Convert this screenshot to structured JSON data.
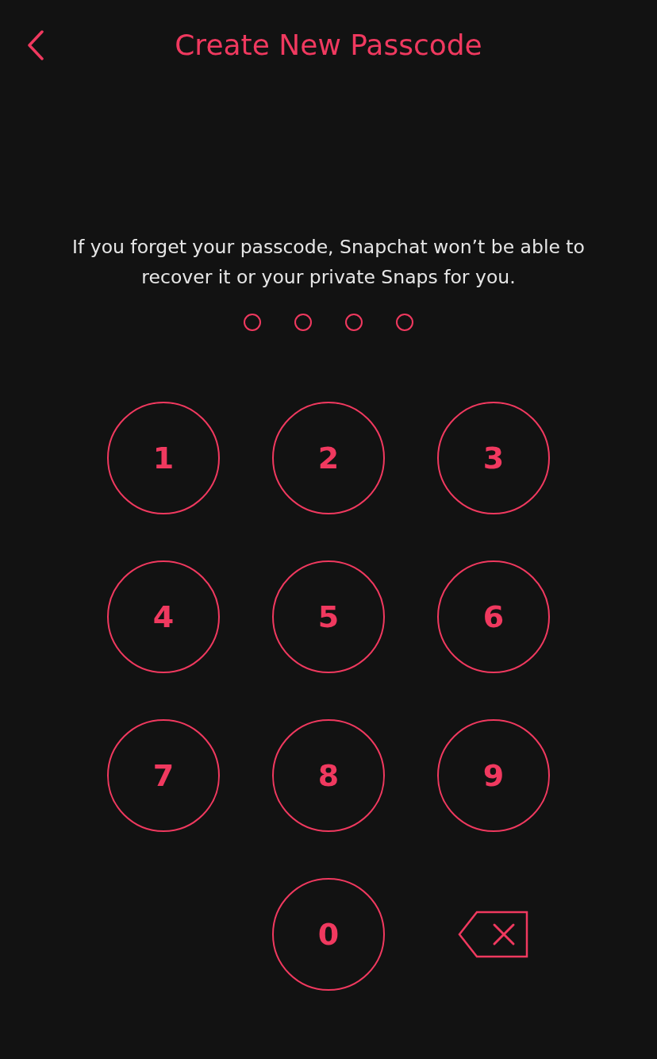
{
  "header": {
    "title": "Create New Passcode"
  },
  "message": "If you forget your passcode, Snapchat won’t be able to recover it or your private Snaps for you.",
  "passcode_dots": [
    {
      "filled": false
    },
    {
      "filled": false
    },
    {
      "filled": false
    },
    {
      "filled": false
    }
  ],
  "keypad": [
    {
      "kind": "digit",
      "label": "1"
    },
    {
      "kind": "digit",
      "label": "2"
    },
    {
      "kind": "digit",
      "label": "3"
    },
    {
      "kind": "digit",
      "label": "4"
    },
    {
      "kind": "digit",
      "label": "5"
    },
    {
      "kind": "digit",
      "label": "6"
    },
    {
      "kind": "digit",
      "label": "7"
    },
    {
      "kind": "digit",
      "label": "8"
    },
    {
      "kind": "digit",
      "label": "9"
    },
    {
      "kind": "digit",
      "label": "0"
    },
    {
      "kind": "delete"
    }
  ]
}
